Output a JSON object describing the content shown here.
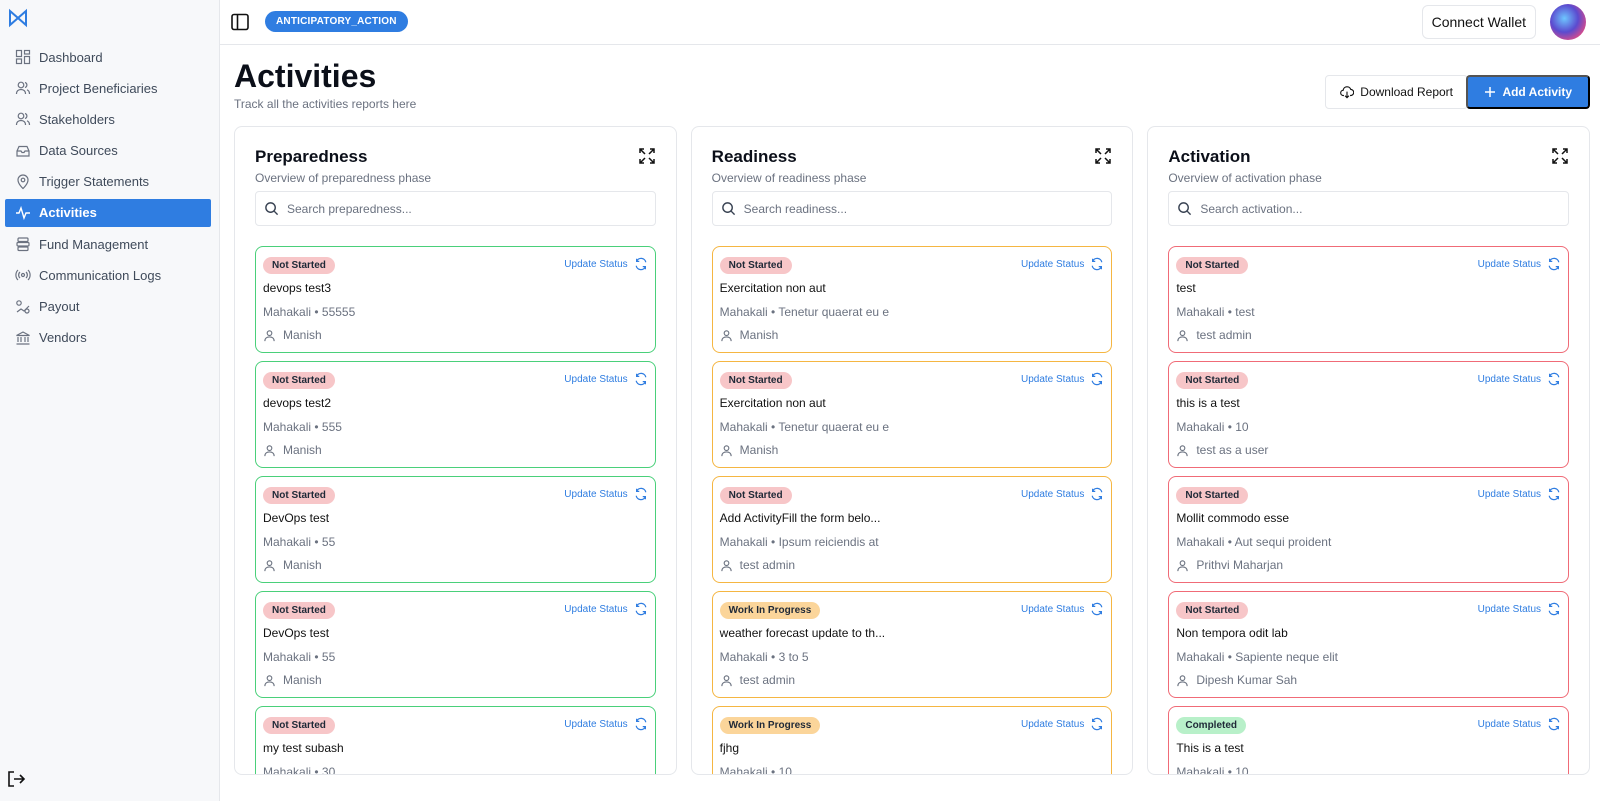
{
  "sidebar": {
    "items": [
      {
        "label": "Dashboard",
        "icon": "dashboard-icon"
      },
      {
        "label": "Project Beneficiaries",
        "icon": "users-icon"
      },
      {
        "label": "Stakeholders",
        "icon": "users-icon"
      },
      {
        "label": "Data Sources",
        "icon": "database-icon"
      },
      {
        "label": "Trigger Statements",
        "icon": "location-icon"
      },
      {
        "label": "Activities",
        "icon": "activity-icon"
      },
      {
        "label": "Fund Management",
        "icon": "coins-icon"
      },
      {
        "label": "Communication Logs",
        "icon": "broadcast-icon"
      },
      {
        "label": "Payout",
        "icon": "payout-icon"
      },
      {
        "label": "Vendors",
        "icon": "bank-icon"
      }
    ]
  },
  "header": {
    "project_badge": "ANTICIPATORY_ACTION",
    "connect_wallet": "Connect Wallet"
  },
  "page": {
    "title": "Activities",
    "subtitle": "Track all the activities reports here",
    "download_label": "Download Report",
    "add_label": "Add Activity"
  },
  "columns": [
    {
      "title": "Preparedness",
      "subtitle": "Overview of preparedness phase",
      "search_placeholder": "Search preparedness...",
      "cards": [
        {
          "status": "Not Started",
          "title": "devops test3",
          "meta": "Mahakali • 55555",
          "user": "Manish"
        },
        {
          "status": "Not Started",
          "title": "devops test2",
          "meta": "Mahakali • 555",
          "user": "Manish"
        },
        {
          "status": "Not Started",
          "title": "DevOps test",
          "meta": "Mahakali • 55",
          "user": "Manish"
        },
        {
          "status": "Not Started",
          "title": "DevOps test",
          "meta": "Mahakali • 55",
          "user": "Manish"
        },
        {
          "status": "Not Started",
          "title": "my test subash",
          "meta": "Mahakali • 30",
          "user": ""
        }
      ]
    },
    {
      "title": "Readiness",
      "subtitle": "Overview of readiness phase",
      "search_placeholder": "Search readiness...",
      "cards": [
        {
          "status": "Not Started",
          "title": "Exercitation non aut",
          "meta": "Mahakali • Tenetur quaerat eu e",
          "user": "Manish"
        },
        {
          "status": "Not Started",
          "title": "Exercitation non aut",
          "meta": "Mahakali • Tenetur quaerat eu e",
          "user": "Manish"
        },
        {
          "status": "Not Started",
          "title": "Add ActivityFill the form belo...",
          "meta": "Mahakali • Ipsum reiciendis at",
          "user": "test admin"
        },
        {
          "status": "Work In Progress",
          "title": "weather forecast update to th...",
          "meta": "Mahakali • 3 to 5",
          "user": "test admin"
        },
        {
          "status": "Work In Progress",
          "title": "fjhg",
          "meta": "Mahakali • 10",
          "user": ""
        }
      ]
    },
    {
      "title": "Activation",
      "subtitle": "Overview of activation phase",
      "search_placeholder": "Search activation...",
      "cards": [
        {
          "status": "Not Started",
          "title": "test",
          "meta": "Mahakali • test",
          "user": "test admin"
        },
        {
          "status": "Not Started",
          "title": "this is a test",
          "meta": "Mahakali • 10",
          "user": "test as a user"
        },
        {
          "status": "Not Started",
          "title": "Mollit commodo esse",
          "meta": "Mahakali • Aut sequi proident",
          "user": "Prithvi Maharjan"
        },
        {
          "status": "Not Started",
          "title": "Non tempora odit lab",
          "meta": "Mahakali • Sapiente neque elit",
          "user": "Dipesh Kumar Sah"
        },
        {
          "status": "Completed",
          "title": "This is a test",
          "meta": "Mahakali • 10",
          "user": ""
        }
      ]
    }
  ],
  "update_status_label": "Update Status",
  "colors": {
    "accent": "#2f7de1",
    "preparedness_border": "#4ad07a",
    "readiness_border": "#f5b642",
    "activation_border": "#f06b77"
  }
}
